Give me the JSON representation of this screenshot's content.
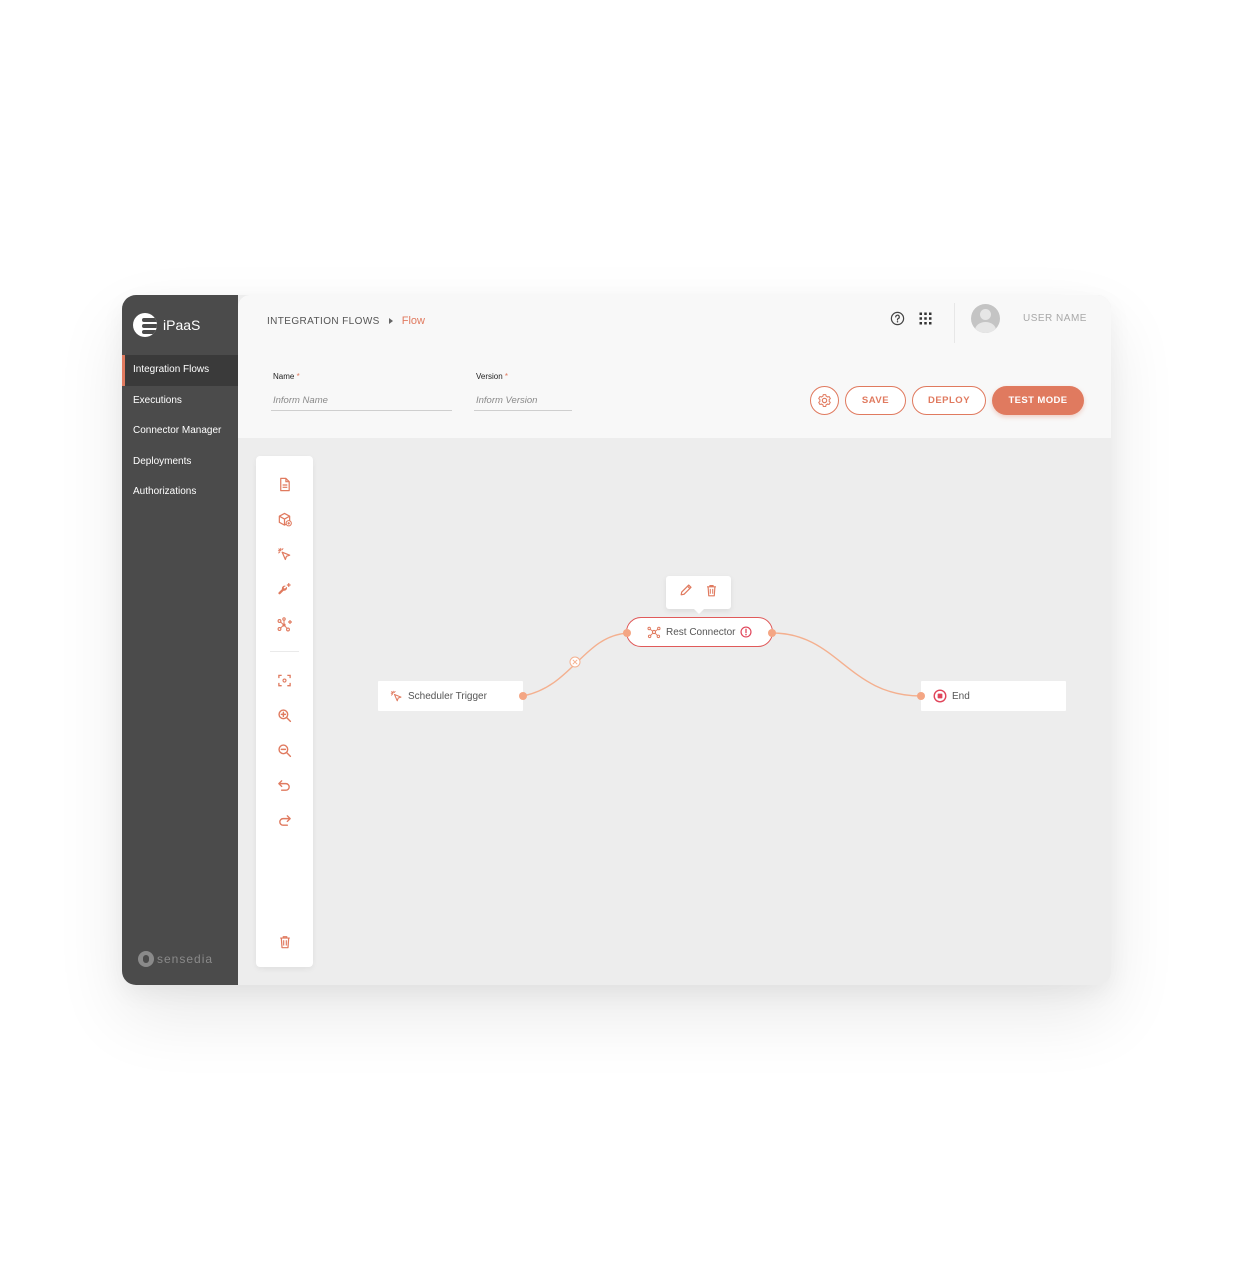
{
  "brand": {
    "name": "iPaaS",
    "footer": "sensedia"
  },
  "sidebar": {
    "items": [
      {
        "label": "Integration Flows",
        "active": true
      },
      {
        "label": "Executions",
        "active": false
      },
      {
        "label": "Connector Manager",
        "active": false
      },
      {
        "label": "Deployments",
        "active": false
      },
      {
        "label": "Authorizations",
        "active": false
      }
    ]
  },
  "header": {
    "breadcrumb_root": "INTEGRATION FLOWS",
    "breadcrumb_current": "Flow",
    "user_name": "USER NAME",
    "icons": [
      "help-icon",
      "apps-grid-icon"
    ]
  },
  "form": {
    "name_label": "Name",
    "name_placeholder": "Inform Name",
    "version_label": "Version",
    "version_placeholder": "Inform Version",
    "required_mark": "*"
  },
  "actions": {
    "settings_icon": "gear-icon",
    "save": "SAVE",
    "deploy": "DEPLOY",
    "test_mode": "TEST MODE"
  },
  "toolbar": {
    "tools": [
      "document-icon",
      "box-add-icon",
      "trigger-cursor-icon",
      "wrench-add-icon",
      "connector-add-icon",
      "fit-view-icon",
      "zoom-in-icon",
      "zoom-out-icon",
      "undo-icon",
      "redo-icon",
      "trash-icon"
    ]
  },
  "flow": {
    "nodes": [
      {
        "id": "scheduler",
        "label": "Scheduler Trigger"
      },
      {
        "id": "rest",
        "label": "Rest Connector",
        "status": "error"
      },
      {
        "id": "end",
        "label": "End"
      }
    ],
    "node_menu": [
      "edit-icon",
      "delete-icon"
    ]
  },
  "colors": {
    "accent": "#e07a5f",
    "sidebar": "#4b4b4b",
    "error": "#e0455a",
    "edge": "#f4b08f"
  }
}
